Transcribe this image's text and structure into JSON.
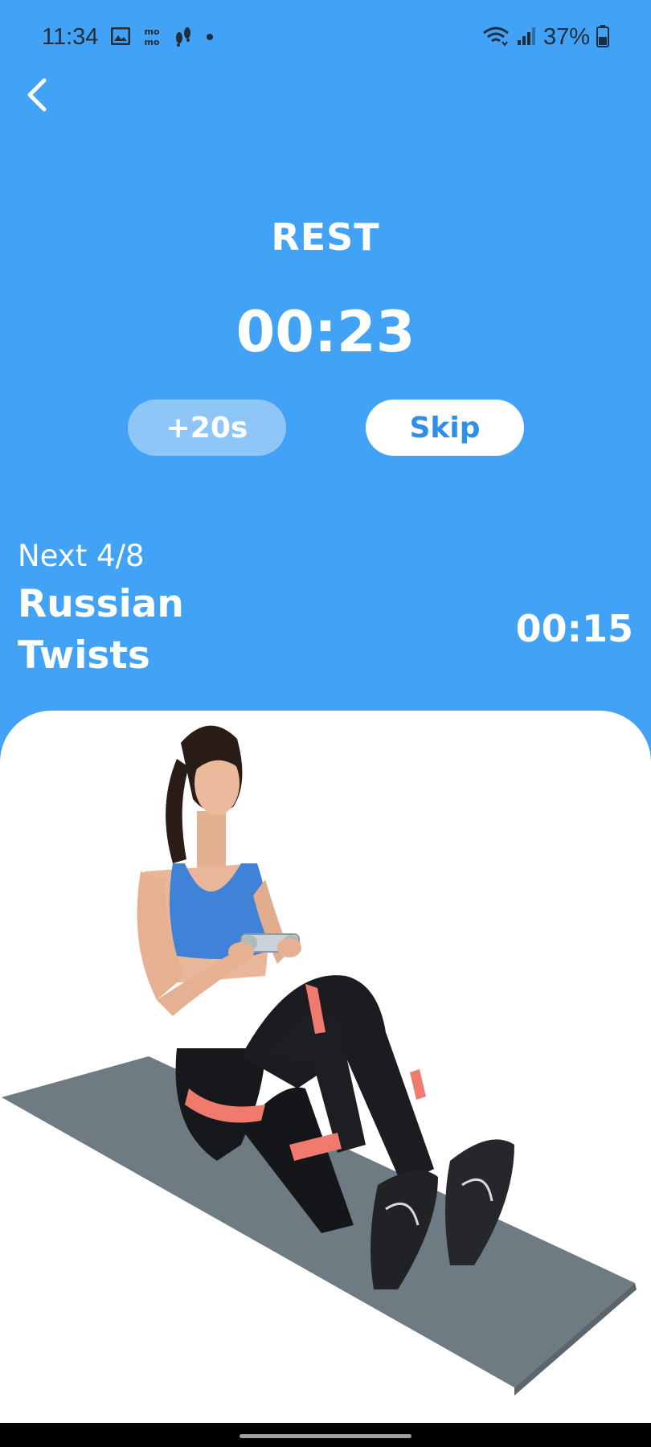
{
  "status_bar": {
    "time": "11:34",
    "battery": "37%",
    "icons": [
      "gallery-icon",
      "momo-icon",
      "steps-icon",
      "dot-icon",
      "wifi-icon",
      "signal-icon",
      "battery-icon"
    ]
  },
  "header": {
    "back_icon": "chevron-left-icon"
  },
  "rest": {
    "title": "REST",
    "timer": "00:23",
    "add_time_label": "+20s",
    "skip_label": "Skip"
  },
  "next": {
    "label": "Next 4/8",
    "exercise_name": "Russian Twists",
    "duration": "00:15"
  },
  "colors": {
    "background": "#42a2f5",
    "pill_add_bg": "#8fc6f8",
    "pill_skip_bg": "#ffffff",
    "skip_text": "#2f8fe8",
    "mat": "#6e7b82"
  }
}
